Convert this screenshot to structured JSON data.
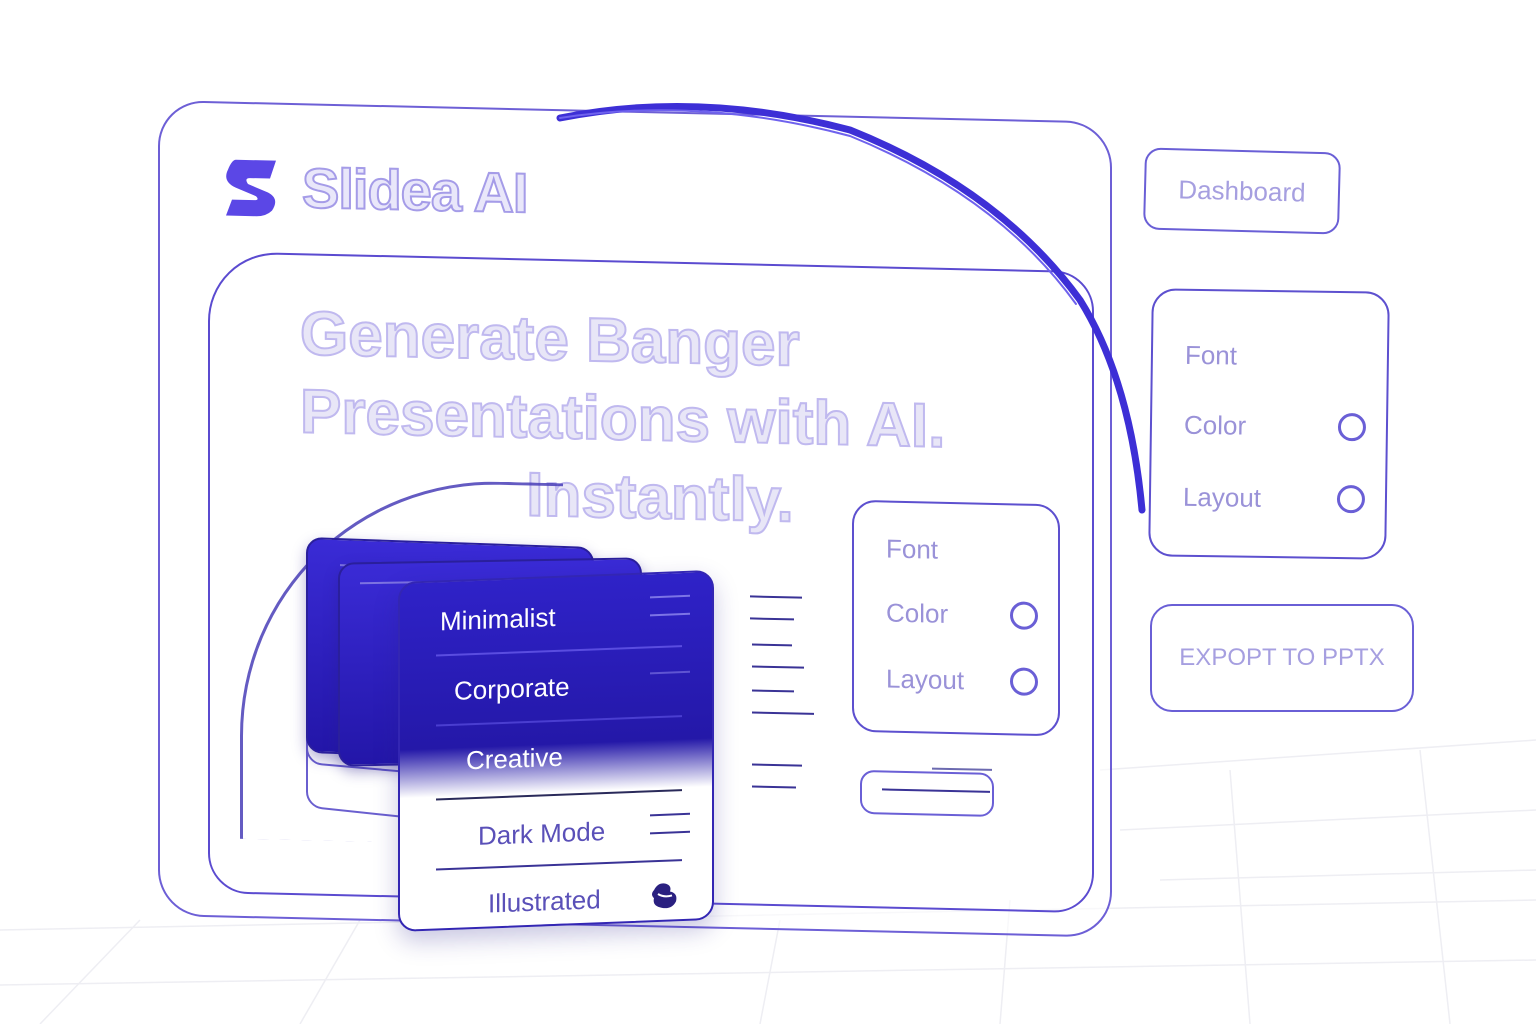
{
  "app": {
    "name": "Slidea AI",
    "logo_icon": "s-logo-icon"
  },
  "hero": {
    "headline_line1": "Generate Banger",
    "headline_line2": "Presentations with AI.",
    "headline_line3": "Instantly."
  },
  "style_menu": {
    "items": [
      {
        "label": "Minimalist"
      },
      {
        "label": "Corporate"
      },
      {
        "label": "Creative"
      },
      {
        "label": "Dark Mode"
      },
      {
        "label": "Illustrated",
        "icon": "blob-icon"
      }
    ]
  },
  "inner_settings": {
    "font_label": "Font",
    "color_label": "Color",
    "layout_label": "Layout"
  },
  "side_settings": {
    "font_label": "Font",
    "color_label": "Color",
    "layout_label": "Layout"
  },
  "actions": {
    "dashboard_label": "Dashboard",
    "export_label": "EXPOPT TO PPTX"
  },
  "colors": {
    "accent": "#3a2bd6",
    "outline": "#6d5fd6",
    "muted_text": "#a59ce8"
  }
}
